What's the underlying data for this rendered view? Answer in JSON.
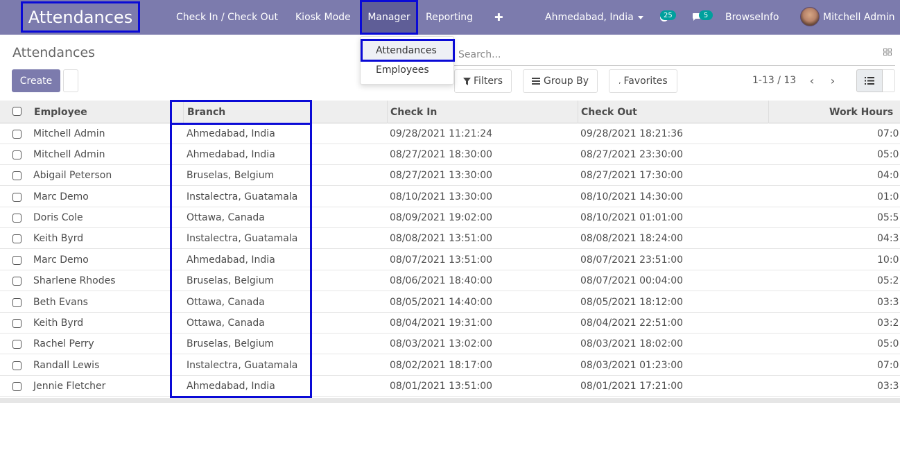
{
  "topbar": {
    "app_title": "Attendances",
    "menu": [
      "Check In / Check Out",
      "Kiosk Mode",
      "Manager",
      "Reporting"
    ],
    "plus": "✚",
    "company": "Ahmedabad, India",
    "activity_count": "25",
    "message_count": "5",
    "company_name": "BrowseInfo",
    "user": "Mitchell Admin"
  },
  "breadcrumb": "Attendances",
  "buttons": {
    "create": "Create"
  },
  "manager_menu": {
    "items": [
      "Attendances",
      "Employees"
    ]
  },
  "search": {
    "placeholder": "Search..."
  },
  "filters": {
    "filters": "Filters",
    "group_by": "Group By",
    "favorites": "Favorites"
  },
  "pager": {
    "text": "1-13 / 13"
  },
  "table": {
    "headers": [
      "Employee",
      "Branch",
      "Check In",
      "Check Out",
      "Work Hours"
    ],
    "rows": [
      [
        "Mitchell Admin",
        "Ahmedabad, India",
        "09/28/2021 11:21:24",
        "09/28/2021 18:21:36",
        "07:0"
      ],
      [
        "Mitchell Admin",
        "Ahmedabad, India",
        "08/27/2021 18:30:00",
        "08/27/2021 23:30:00",
        "05:0"
      ],
      [
        "Abigail Peterson",
        "Bruselas, Belgium",
        "08/27/2021 13:30:00",
        "08/27/2021 17:30:00",
        "04:0"
      ],
      [
        "Marc Demo",
        "Instalectra, Guatamala",
        "08/10/2021 13:30:00",
        "08/10/2021 14:30:00",
        "01:0"
      ],
      [
        "Doris Cole",
        "Ottawa, Canada",
        "08/09/2021 19:02:00",
        "08/10/2021 01:01:00",
        "05:5"
      ],
      [
        "Keith Byrd",
        "Instalectra, Guatamala",
        "08/08/2021 13:51:00",
        "08/08/2021 18:24:00",
        "04:3"
      ],
      [
        "Marc Demo",
        "Ahmedabad, India",
        "08/07/2021 13:51:00",
        "08/07/2021 23:51:00",
        "10:0"
      ],
      [
        "Sharlene Rhodes",
        "Bruselas, Belgium",
        "08/06/2021 18:40:00",
        "08/07/2021 00:04:00",
        "05:2"
      ],
      [
        "Beth Evans",
        "Ottawa, Canada",
        "08/05/2021 14:40:00",
        "08/05/2021 18:12:00",
        "03:3"
      ],
      [
        "Keith Byrd",
        "Ottawa, Canada",
        "08/04/2021 19:31:00",
        "08/04/2021 22:51:00",
        "03:2"
      ],
      [
        "Rachel Perry",
        "Bruselas, Belgium",
        "08/03/2021 13:02:00",
        "08/03/2021 18:02:00",
        "05:0"
      ],
      [
        "Randall Lewis",
        "Instalectra, Guatamala",
        "08/02/2021 18:17:00",
        "08/03/2021 01:23:00",
        "07:0"
      ],
      [
        "Jennie Fletcher",
        "Ahmedabad, India",
        "08/01/2021 13:51:00",
        "08/01/2021 17:21:00",
        "03:3"
      ]
    ]
  }
}
